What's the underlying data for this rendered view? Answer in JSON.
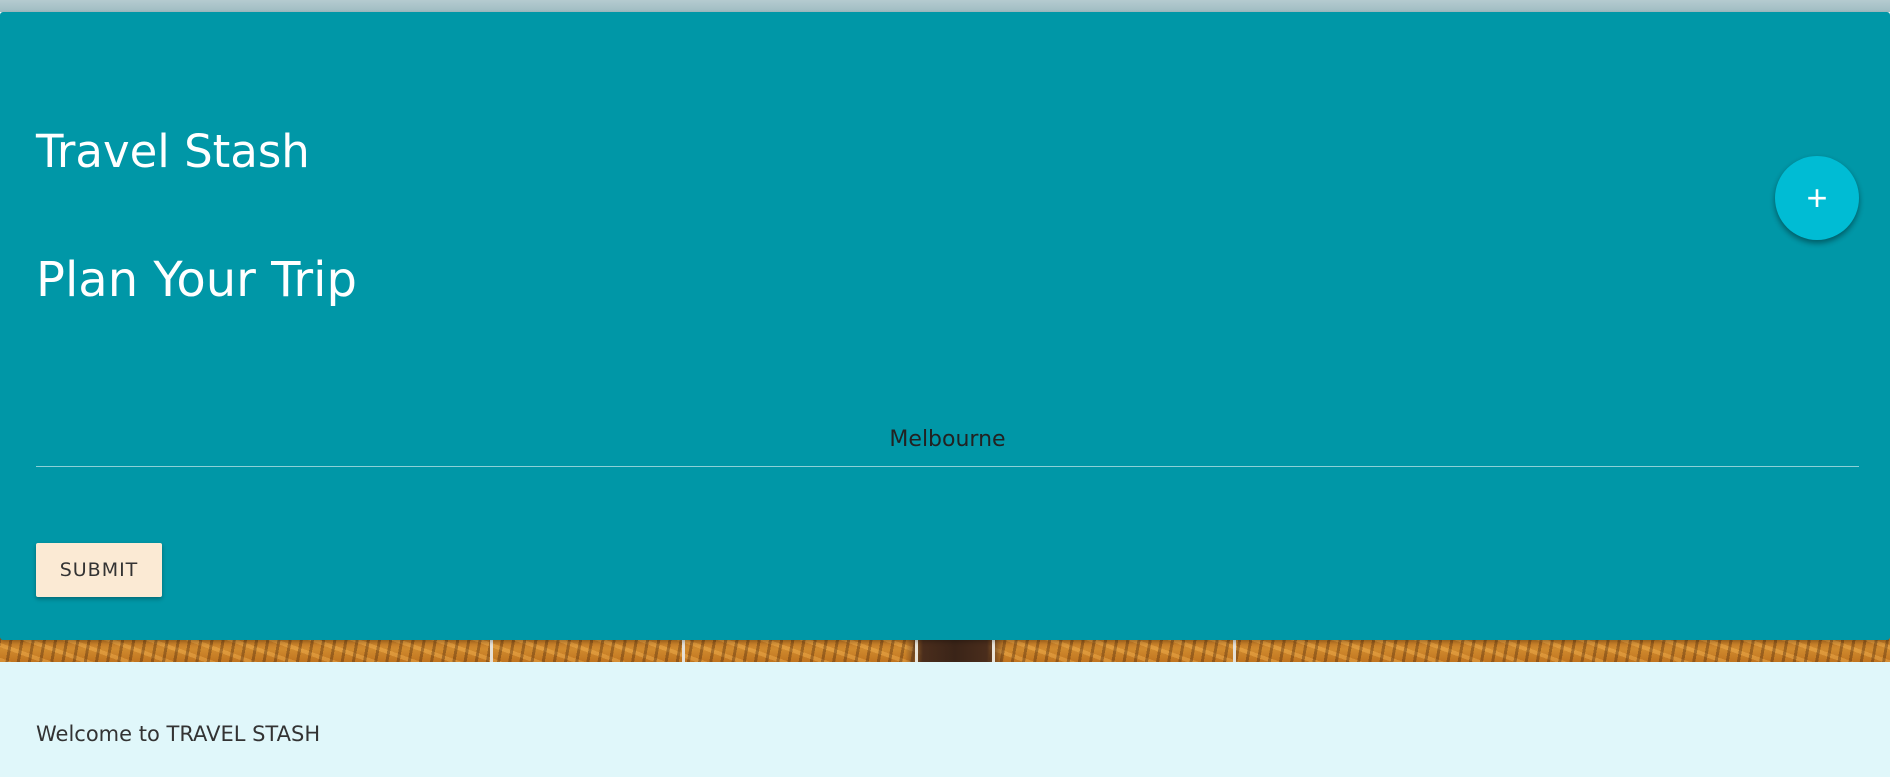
{
  "app": {
    "title": "Travel Stash"
  },
  "planner": {
    "heading": "Plan Your Trip",
    "destination_value": "Melbourne",
    "submit_label": "SUBMIT",
    "add_button_glyph": "+"
  },
  "footer": {
    "welcome_text": "Welcome to TRAVEL STASH"
  },
  "colors": {
    "card_background": "#0097a7",
    "fab_background": "#00bcd4",
    "submit_background": "#fbead4",
    "footer_background": "#e0f7fa"
  },
  "icons": {
    "fab_icon": "plus-icon"
  }
}
